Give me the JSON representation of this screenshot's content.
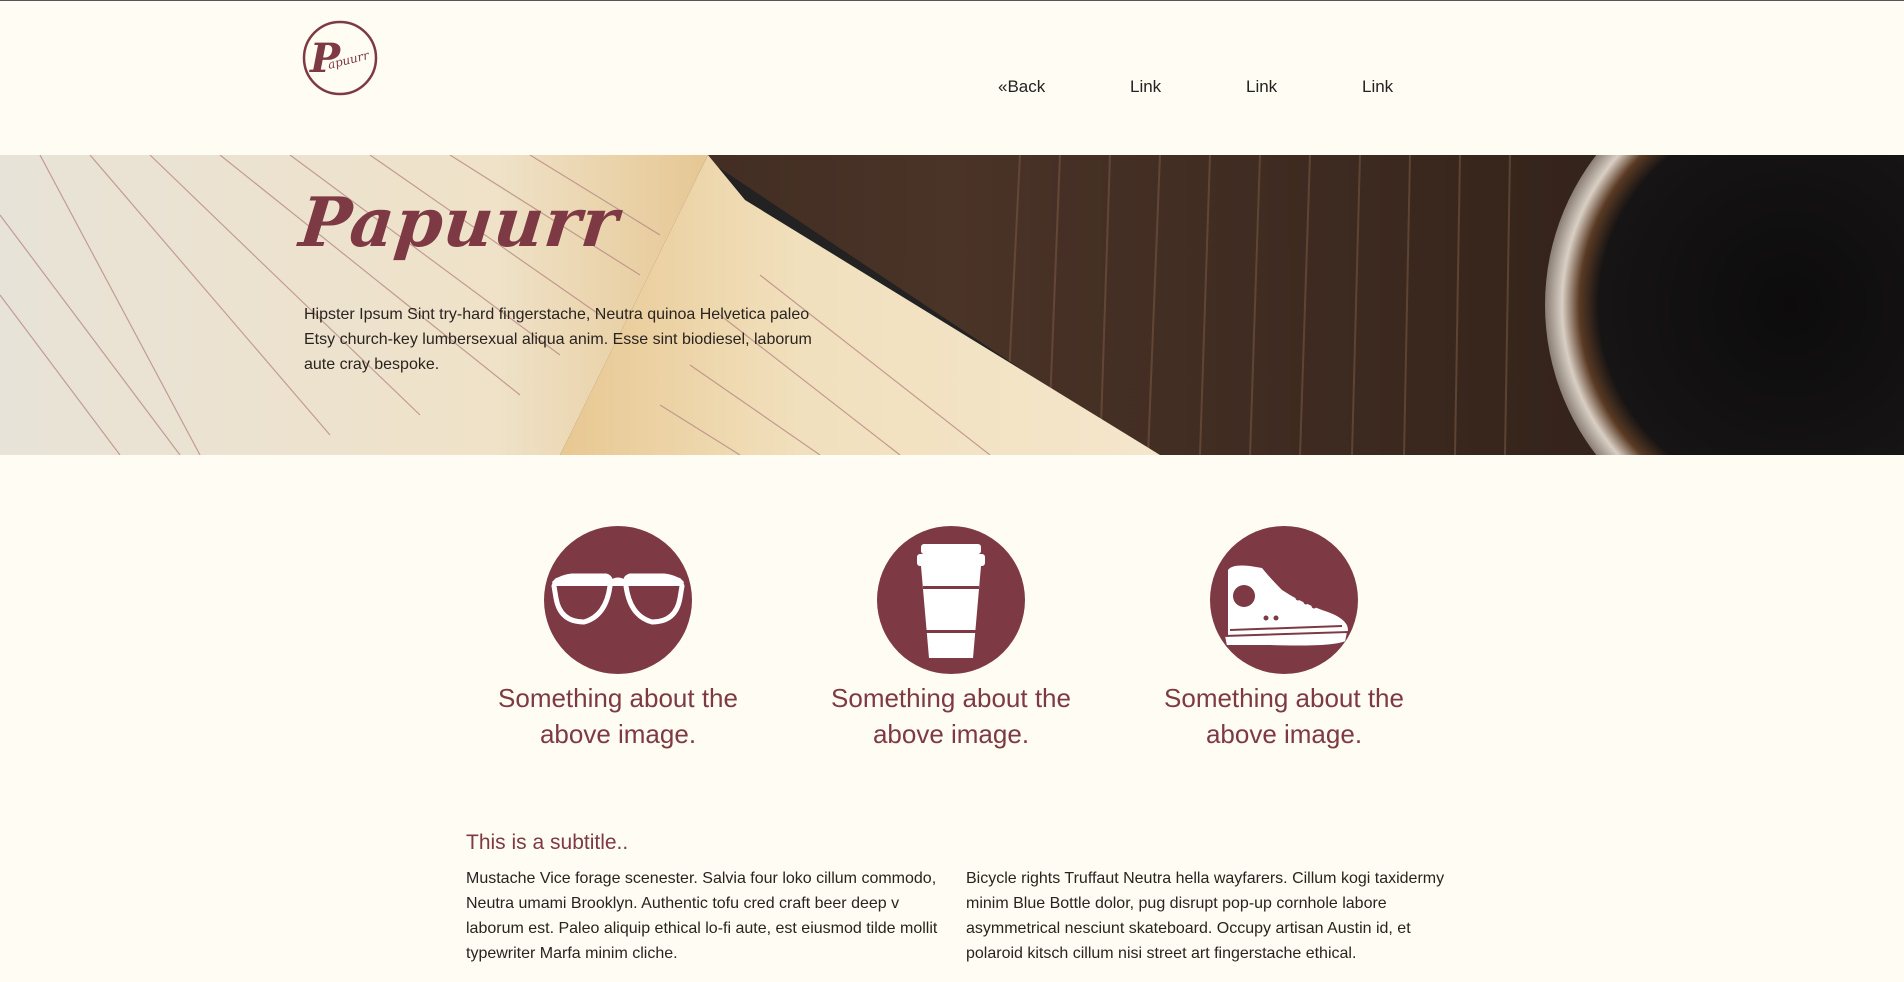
{
  "brand": {
    "logo_text": "Papuurr",
    "accent_color": "#7e3a44",
    "background_color": "#fffcf3"
  },
  "nav": {
    "items": [
      {
        "label": "«Back"
      },
      {
        "label": "Link"
      },
      {
        "label": "Link"
      },
      {
        "label": "Link"
      }
    ]
  },
  "hero": {
    "title": "Papuurr",
    "text": "Hipster Ipsum Sint try-hard fingerstache, Neutra quinoa Helvetica paleo Etsy church-key lumbersexual aliqua anim. Esse sint biodiesel, laborum aute cray bespoke."
  },
  "features": [
    {
      "icon": "glasses-icon",
      "caption": "Something about the above image."
    },
    {
      "icon": "coffee-cup-icon",
      "caption": "Something about the above image."
    },
    {
      "icon": "sneaker-icon",
      "caption": "Something about the above image."
    }
  ],
  "content": {
    "subtitle": "This is a subtitle..",
    "columns": [
      {
        "text": "Mustache Vice forage scenester. Salvia four loko cillum commodo, Neutra umami Brooklyn. Authentic tofu cred craft beer deep v laborum est. Paleo aliquip ethical lo-fi aute, est eiusmod tilde mollit typewriter Marfa minim cliche."
      },
      {
        "text": "Bicycle rights Truffaut Neutra hella wayfarers. Cillum kogi taxidermy minim Blue Bottle dolor, pug disrupt pop-up cornhole labore asymmetrical nesciunt skateboard. Occupy artisan Austin id, et polaroid kitsch cillum nisi street art fingerstache ethical."
      }
    ]
  }
}
